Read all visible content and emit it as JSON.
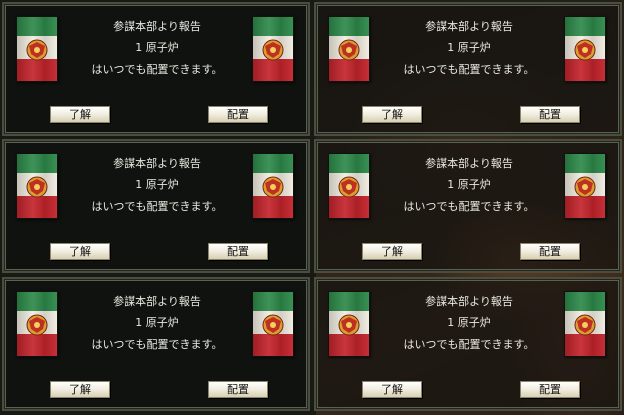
{
  "colors": {
    "panel_bg": "#10120e",
    "panel_border": "#4a4e40",
    "text": "#e8e8e0",
    "flag_green": "#2e8a4a",
    "flag_white": "#f0ece0",
    "flag_red": "#c4242c",
    "button_face": "#f2efe2"
  },
  "flag_icon": "tricolor-flag-with-eagle-emblem",
  "dialogs": [
    {
      "title": "参謀本部より報告",
      "item": "1 原子炉",
      "message": "はいつでも配置できます。",
      "ok_label": "了解",
      "deploy_label": "配置"
    },
    {
      "title": "参謀本部より報告",
      "item": "1 原子炉",
      "message": "はいつでも配置できます。",
      "ok_label": "了解",
      "deploy_label": "配置"
    },
    {
      "title": "参謀本部より報告",
      "item": "1 原子炉",
      "message": "はいつでも配置できます。",
      "ok_label": "了解",
      "deploy_label": "配置"
    },
    {
      "title": "参謀本部より報告",
      "item": "1 原子炉",
      "message": "はいつでも配置できます。",
      "ok_label": "了解",
      "deploy_label": "配置"
    },
    {
      "title": "参謀本部より報告",
      "item": "1 原子炉",
      "message": "はいつでも配置できます。",
      "ok_label": "了解",
      "deploy_label": "配置"
    },
    {
      "title": "参謀本部より報告",
      "item": "1 原子炉",
      "message": "はいつでも配置できます。",
      "ok_label": "了解",
      "deploy_label": "配置"
    }
  ]
}
